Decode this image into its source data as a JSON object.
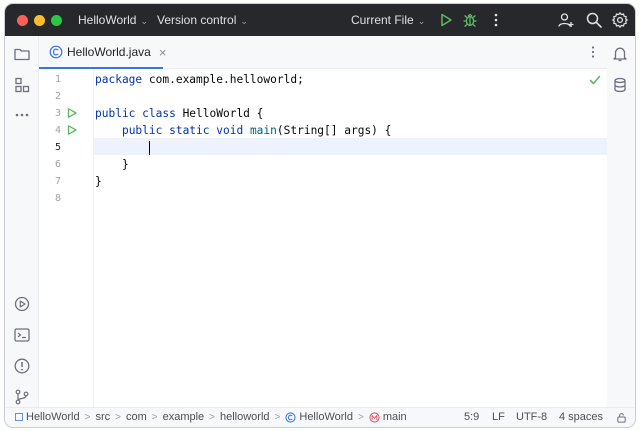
{
  "titlebar": {
    "project": "HelloWorld",
    "vcs": "Version control",
    "run_config": "Current File",
    "colors": {
      "close": "#ff5f57",
      "minimize": "#febc2e",
      "maximize": "#28c840",
      "run": "#5fb865"
    }
  },
  "left_toolbar": {
    "items": [
      "folder-icon",
      "structure-icon",
      "more-icon"
    ],
    "bottom_items": [
      "services-icon",
      "terminal-icon",
      "problems-icon",
      "git-icon"
    ]
  },
  "right_toolbar": {
    "items": [
      "notifications-icon",
      "database-icon"
    ]
  },
  "tabs": [
    {
      "label": "HelloWorld.java",
      "icon": "class-c-icon",
      "active": true
    }
  ],
  "editor": {
    "line_numbers": [
      "1",
      "2",
      "3",
      "4",
      "5",
      "6",
      "7",
      "8"
    ],
    "current_line": "5",
    "lines": {
      "l1_kw": "package",
      "l1_rest": " com.example.helloworld;",
      "l3_kw": "public class",
      "l3_rest": " HelloWorld {",
      "l4_kw": "public static void",
      "l4_fn": " main",
      "l4_rest": "(String[] args) {",
      "l6": "}",
      "l7": "}"
    },
    "inspection_status": "ok"
  },
  "breadcrumb": [
    "HelloWorld",
    "src",
    "com",
    "example",
    "helloworld",
    "HelloWorld",
    "main"
  ],
  "status": {
    "position": "5:9",
    "line_separator": "LF",
    "encoding": "UTF-8",
    "indent": "4 spaces"
  }
}
